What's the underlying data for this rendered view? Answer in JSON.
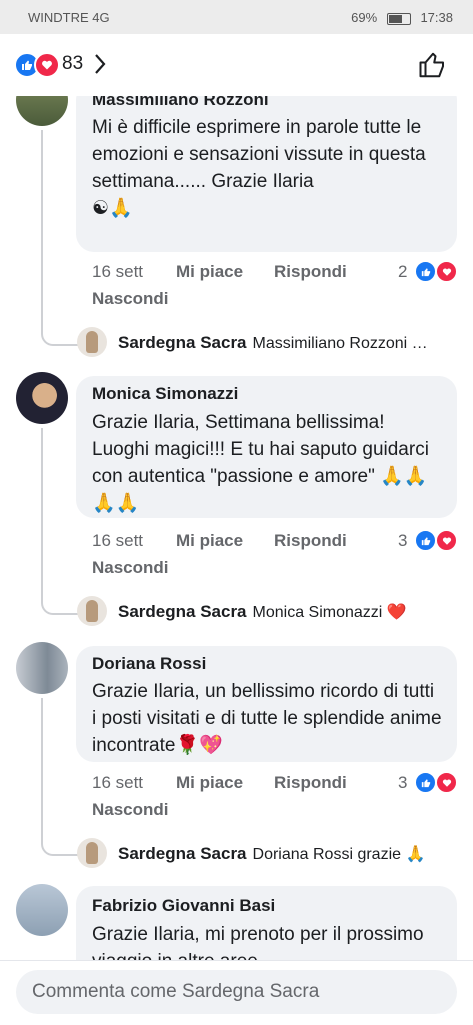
{
  "status_bar": {
    "carrier": "WINDTRE 4G",
    "battery": "69%",
    "time": "17:38"
  },
  "reactions": {
    "count": "83",
    "like_color": "#1877f2",
    "love_color": "#f0284a"
  },
  "comments": [
    {
      "author": "Massimiliano Rozzoni",
      "text": "Mi è difficile esprimere in parole tutte le emozioni e sensazioni vissute in questa settimana...... Grazie Ilaria",
      "emoji": "☯🙏",
      "date": "16 sett",
      "like": "Mi piace",
      "reply": "Rispondi",
      "hide": "Nascondi",
      "reaction_count": "2",
      "reply_author": "Sardegna Sacra",
      "reply_text": "Massimiliano Rozzoni …"
    },
    {
      "author": "Monica Simonazzi",
      "text": "Grazie Ilaria, Settimana bellissima! Luoghi magici!!! E tu hai saputo guidarci con autentica \"passione e amore\"",
      "emoji": "🙏🙏🙏🙏",
      "date": "16 sett",
      "like": "Mi piace",
      "reply": "Rispondi",
      "hide": "Nascondi",
      "reaction_count": "3",
      "reply_author": "Sardegna Sacra",
      "reply_text": "Monica Simonazzi ❤️"
    },
    {
      "author": "Doriana Rossi",
      "text": "Grazie Ilaria, un bellissimo ricordo di tutti i posti visitati e di tutte le splendide anime incontrate",
      "emoji": "🌹💖",
      "date": "16 sett",
      "like": "Mi piace",
      "reply": "Rispondi",
      "hide": "Nascondi",
      "reaction_count": "3",
      "reply_author": "Sardegna Sacra",
      "reply_text": "Doriana Rossi grazie 🙏"
    },
    {
      "author": "Fabrizio Giovanni Basi",
      "text": "Grazie Ilaria, mi prenoto per il prossimo viaggio in altre aree"
    }
  ],
  "comment_input": {
    "placeholder": "Commenta come Sardegna Sacra"
  }
}
